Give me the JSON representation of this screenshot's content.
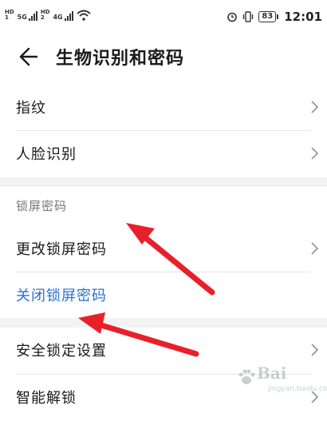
{
  "status_bar": {
    "sim1": "HD",
    "sim1_sub": "1",
    "net1": "5G",
    "sim2": "HD",
    "sim2_sub": "2",
    "net2": "4G",
    "battery": "83",
    "time": "12:01"
  },
  "header": {
    "title": "生物识别和密码"
  },
  "rows": {
    "fingerprint": "指纹",
    "face": "人脸识别",
    "section_lock": "锁屏密码",
    "change_password": "更改锁屏密码",
    "disable_password": "关闭锁屏密码",
    "security_lock": "安全锁定设置",
    "smart_unlock": "智能解锁"
  },
  "colors": {
    "accent_blue": "#2f6fcf",
    "annotation_red": "#e8202a"
  },
  "icons": [
    "back-arrow-icon",
    "chevron-right-icon",
    "wifi-icon",
    "alarm-icon",
    "vibrate-icon",
    "battery-icon",
    "signal-icon"
  ],
  "watermark": {
    "text": "Bai",
    "sub": "jingyan.baidu.com"
  }
}
